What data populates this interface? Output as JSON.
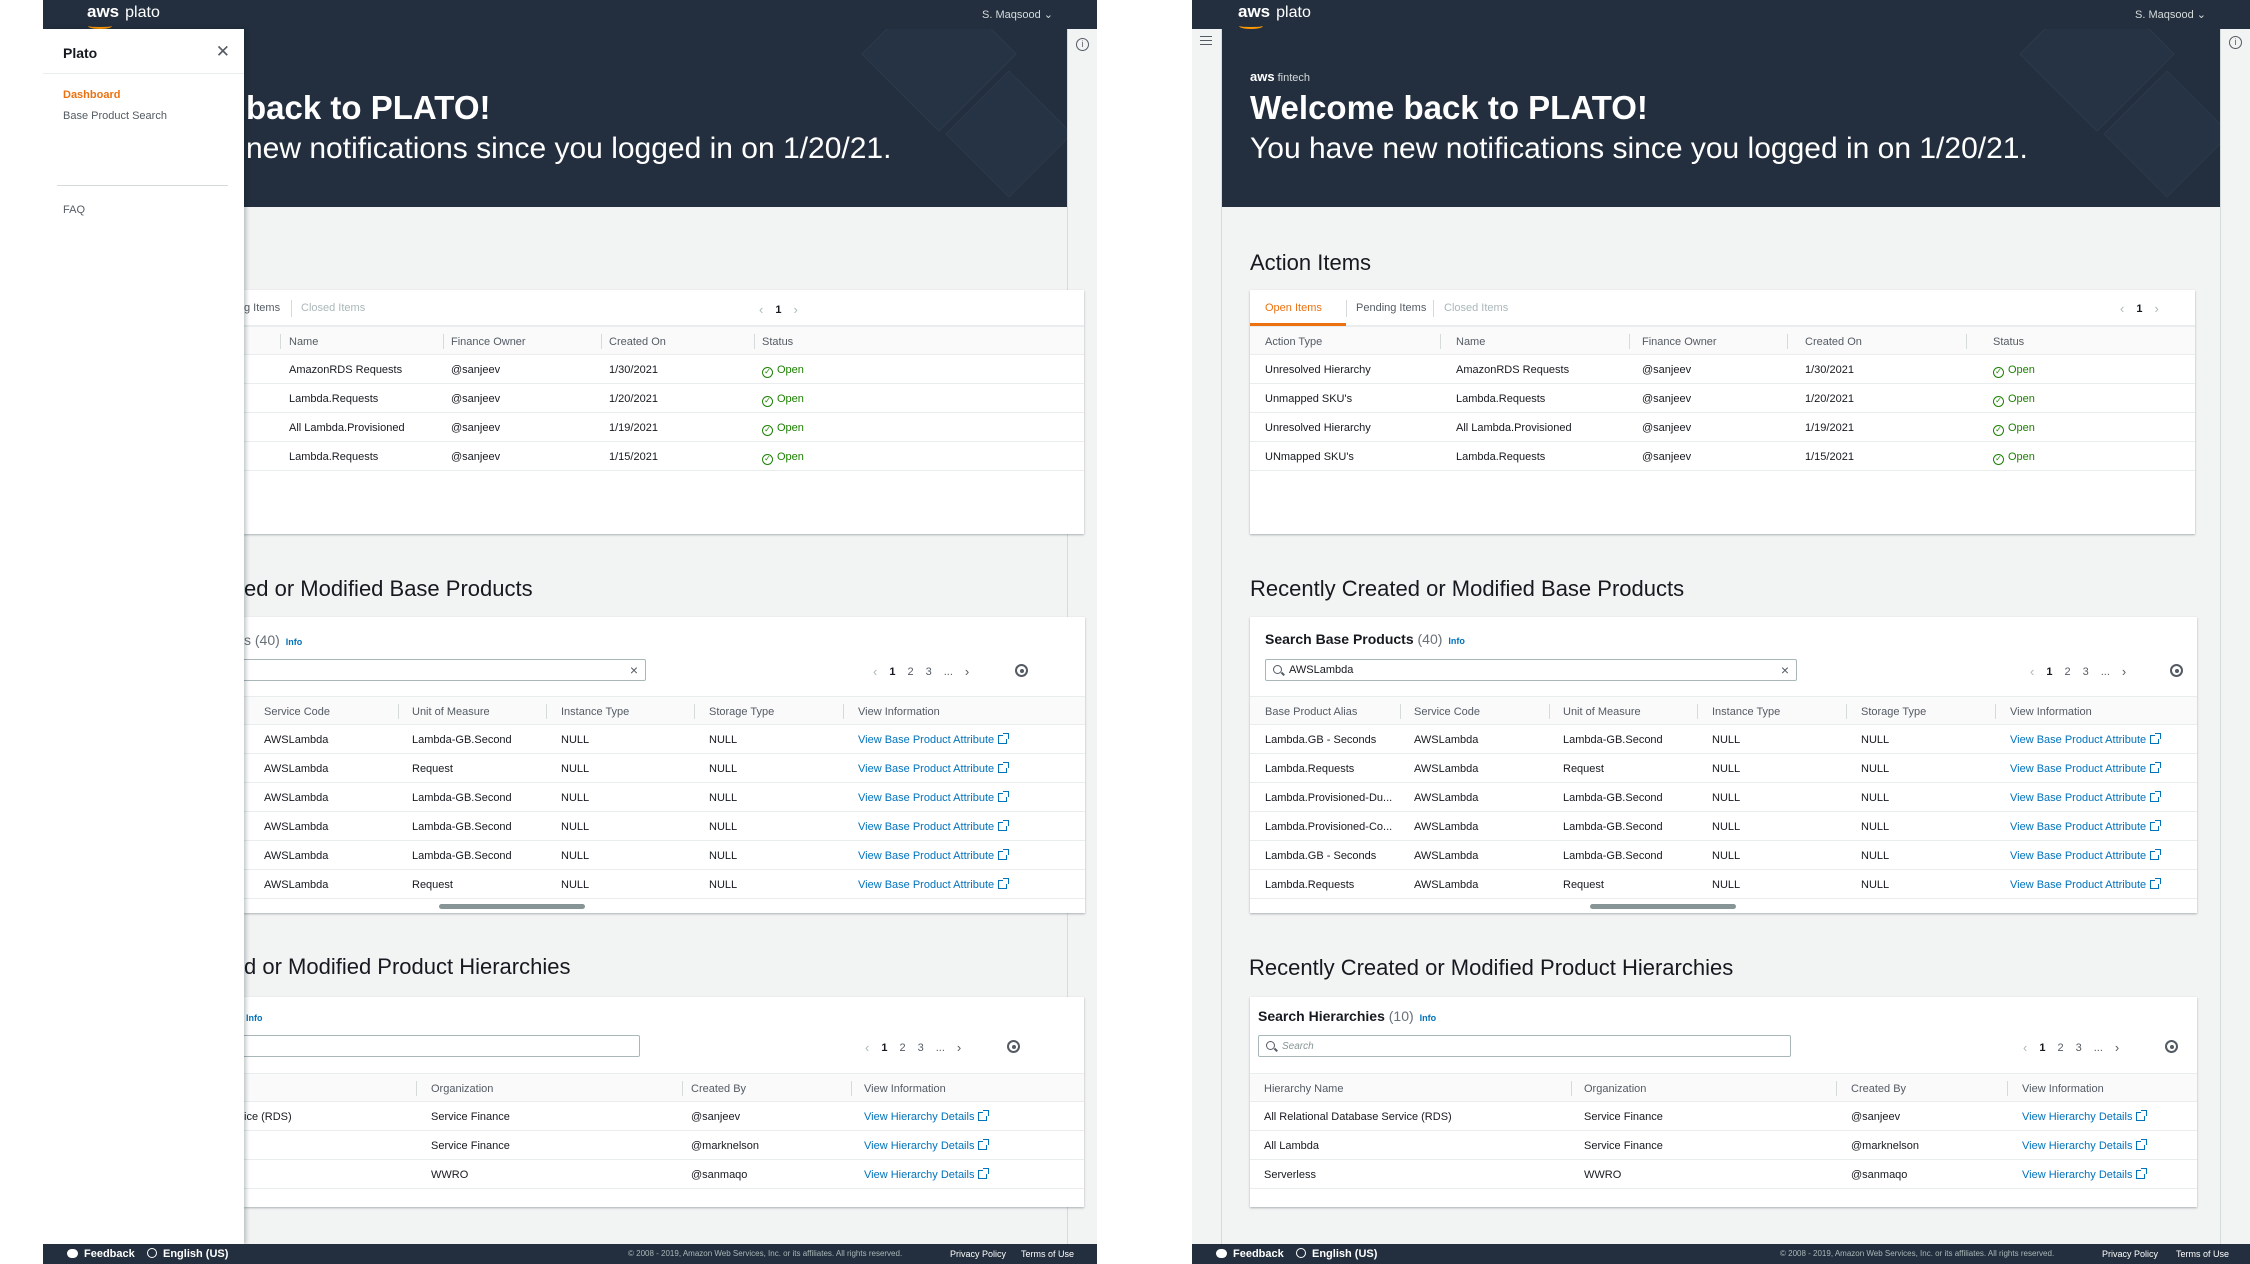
{
  "topbar": {
    "brand": "aws",
    "product": "plato",
    "user": "S. Maqsood ⌄"
  },
  "hero": {
    "subbrand": "aws",
    "subbrand_suffix": "fintech",
    "title": "Welcome back to PLATO!",
    "subtitle": "You have new notifications since you logged in on 1/20/21."
  },
  "left_hero": {
    "title": "back to PLATO!",
    "subtitle": "new notifications since you logged in on 1/20/21."
  },
  "drawer": {
    "title": "Plato",
    "items": [
      "Dashboard",
      "Base Product Search"
    ],
    "faq": "FAQ"
  },
  "action_items": {
    "title": "Action Items",
    "tabs": [
      "Open Items",
      "Pending Items",
      "Closed Items"
    ],
    "left_tab_fragment": "g Items",
    "page": "1",
    "columns": [
      "Action Type",
      "Name",
      "Finance Owner",
      "Created On",
      "Status"
    ],
    "rows": [
      [
        "Unresolved Hierarchy",
        "AmazonRDS Requests",
        "@sanjeev",
        "1/30/2021",
        "Open"
      ],
      [
        "Unmapped SKU's",
        "Lambda.Requests",
        "@sanjeev",
        "1/20/2021",
        "Open"
      ],
      [
        "Unresolved Hierarchy",
        "All Lambda.Provisioned",
        "@sanjeev",
        "1/19/2021",
        "Open"
      ],
      [
        "UNmapped SKU's",
        "Lambda.Requests",
        "@sanjeev",
        "1/15/2021",
        "Open"
      ]
    ]
  },
  "base_products": {
    "title": "Recently Created or Modified Base Products",
    "left_title": "ed or Modified Base Products",
    "search_label": "Search Base Products",
    "count": "(40)",
    "left_count_fragment": "s (40)",
    "info": "Info",
    "search_value": "AWSLambda",
    "pages": [
      "1",
      "2",
      "3",
      "..."
    ],
    "columns": [
      "Base Product Alias",
      "Service Code",
      "Unit of Measure",
      "Instance Type",
      "Storage Type",
      "View Information"
    ],
    "rows": [
      [
        "Lambda.GB - Seconds",
        "AWSLambda",
        "Lambda-GB.Second",
        "NULL",
        "NULL",
        "View Base Product Attribute"
      ],
      [
        "Lambda.Requests",
        "AWSLambda",
        "Request",
        "NULL",
        "NULL",
        "View Base Product Attribute"
      ],
      [
        "Lambda.Provisioned-Du...",
        "AWSLambda",
        "Lambda-GB.Second",
        "NULL",
        "NULL",
        "View Base Product Attribute"
      ],
      [
        "Lambda.Provisioned-Co...",
        "AWSLambda",
        "Lambda-GB.Second",
        "NULL",
        "NULL",
        "View Base Product Attribute"
      ],
      [
        "Lambda.GB - Seconds",
        "AWSLambda",
        "Lambda-GB.Second",
        "NULL",
        "NULL",
        "View Base Product Attribute"
      ],
      [
        "Lambda.Requests",
        "AWSLambda",
        "Request",
        "NULL",
        "NULL",
        "View Base Product Attribute"
      ]
    ]
  },
  "hierarchies": {
    "title": "Recently Created or Modified Product Hierarchies",
    "left_title": "d or Modified Product Hierarchies",
    "search_label": "Search Hierarchies",
    "count": "(10)",
    "info": "Info",
    "placeholder": "Search",
    "pages": [
      "1",
      "2",
      "3",
      "..."
    ],
    "columns": [
      "Hierarchy Name",
      "Organization",
      "Created By",
      "View Information"
    ],
    "rows": [
      [
        "All Relational Database Service (RDS)",
        "Service Finance",
        "@sanjeev",
        "View Hierarchy Details"
      ],
      [
        "All Lambda",
        "Service Finance",
        "@marknelson",
        "View Hierarchy Details"
      ],
      [
        "Serverless",
        "WWRO",
        "@sanmaqo",
        "View Hierarchy Details"
      ]
    ],
    "left_first_fragment": "ice (RDS)"
  },
  "footer": {
    "feedback": "Feedback",
    "language": "English (US)",
    "copyright": "© 2008 - 2019, Amazon Web Services, Inc. or its affiliates. All rights reserved.",
    "privacy": "Privacy Policy",
    "terms": "Terms of Use"
  },
  "colors": {
    "navy": "#232f3e",
    "accent": "#ec7211",
    "link": "#0073bb",
    "success": "#1d8102"
  }
}
